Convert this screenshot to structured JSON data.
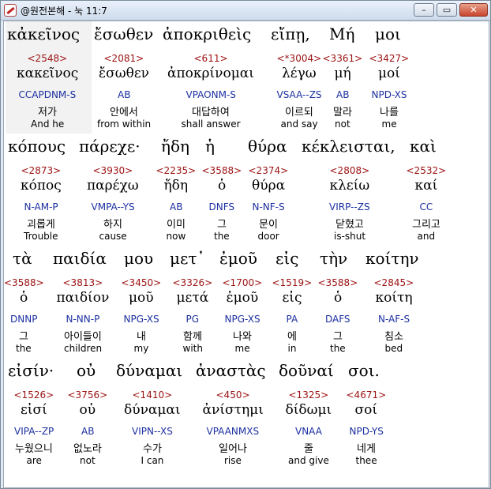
{
  "window": {
    "title": "@원전본해 - 눅 11:7",
    "min_label": "–",
    "max_label": "▭",
    "close_label": "✕"
  },
  "lines": [
    {
      "words": [
        {
          "greek": "κἀκεῖνος",
          "strong": "<2548>",
          "lemma": "κακεῖνος",
          "morph": "CCAPDNM-S",
          "korean": "저가",
          "english": "And he"
        },
        {
          "greek": "ἔσωθεν",
          "strong": "<2081>",
          "lemma": "ἔσωθεν",
          "morph": "AB",
          "korean": "안에서",
          "english": "from within"
        },
        {
          "greek": "ἀποκριθεὶς",
          "strong": "<611>",
          "lemma": "ἀποκρίνομαι",
          "morph": "VPAONM-S",
          "korean": "대답하여",
          "english": "shall answer"
        },
        {
          "greek": "εἴπῃ,",
          "strong": "<*3004>",
          "lemma": "λέγω",
          "morph": "VSAA--ZS",
          "korean": "이르되",
          "english": "and say"
        },
        {
          "greek": "Μή",
          "strong": "<3361>",
          "lemma": "μή",
          "morph": "AB",
          "korean": "말라",
          "english": "not"
        },
        {
          "greek": "μοι",
          "strong": "<3427>",
          "lemma": "μοί",
          "morph": "NPD-XS",
          "korean": "나를",
          "english": "me"
        }
      ]
    },
    {
      "words": [
        {
          "greek": "κόπους",
          "strong": "<2873>",
          "lemma": "κόπος",
          "morph": "N-AM-P",
          "korean": "괴롭게",
          "english": "Trouble"
        },
        {
          "greek": "πάρεχε·",
          "strong": "<3930>",
          "lemma": "παρέχω",
          "morph": "VMPA--YS",
          "korean": "하지",
          "english": "cause"
        },
        {
          "greek": "ἤδη",
          "strong": "<2235>",
          "lemma": "ἤδη",
          "morph": "AB",
          "korean": "이미",
          "english": "now"
        },
        {
          "greek": "ἡ",
          "strong": "<3588>",
          "lemma": "ὁ",
          "morph": "DNFS",
          "korean": "그",
          "english": "the"
        },
        {
          "greek": "θύρα",
          "strong": "<2374>",
          "lemma": "θύρα",
          "morph": "N-NF-S",
          "korean": "문이",
          "english": "door"
        },
        {
          "greek": "κέκλεισται,",
          "strong": "<2808>",
          "lemma": "κλείω",
          "morph": "VIRP--ZS",
          "korean": "닫혔고",
          "english": "is-shut"
        },
        {
          "greek": "καὶ",
          "strong": "<2532>",
          "lemma": "καί",
          "morph": "CC",
          "korean": "그리고",
          "english": "and"
        }
      ]
    },
    {
      "words": [
        {
          "greek": "τὰ",
          "strong": "<3588>",
          "lemma": "ὁ",
          "morph": "DNNP",
          "korean": "그",
          "english": "the"
        },
        {
          "greek": "παιδία",
          "strong": "<3813>",
          "lemma": "παιδίον",
          "morph": "N-NN-P",
          "korean": "아이들이",
          "english": "children"
        },
        {
          "greek": "μου",
          "strong": "<3450>",
          "lemma": "μοῦ",
          "morph": "NPG-XS",
          "korean": "내",
          "english": "my"
        },
        {
          "greek": "μετ᾽",
          "strong": "<3326>",
          "lemma": "μετά",
          "morph": "PG",
          "korean": "함께",
          "english": "with"
        },
        {
          "greek": "ἐμοῦ",
          "strong": "<1700>",
          "lemma": "ἐμοῦ",
          "morph": "NPG-XS",
          "korean": "나와",
          "english": "me"
        },
        {
          "greek": "εἰς",
          "strong": "<1519>",
          "lemma": "εἰς",
          "morph": "PA",
          "korean": "에",
          "english": "in"
        },
        {
          "greek": "τὴν",
          "strong": "<3588>",
          "lemma": "ὁ",
          "morph": "DAFS",
          "korean": "그",
          "english": "the"
        },
        {
          "greek": "κοίτην",
          "strong": "<2845>",
          "lemma": "κοίτη",
          "morph": "N-AF-S",
          "korean": "침소",
          "english": "bed"
        }
      ]
    },
    {
      "words": [
        {
          "greek": "εἰσίν·",
          "strong": "<1526>",
          "lemma": "εἰσί",
          "morph": "VIPA--ZP",
          "korean": "누웠으니",
          "english": "are"
        },
        {
          "greek": "οὐ",
          "strong": "<3756>",
          "lemma": "οὐ",
          "morph": "AB",
          "korean": "없노라",
          "english": "not"
        },
        {
          "greek": "δύναμαι",
          "strong": "<1410>",
          "lemma": "δύναμαι",
          "morph": "VIPN--XS",
          "korean": "수가",
          "english": "I can"
        },
        {
          "greek": "ἀναστὰς",
          "strong": "<450>",
          "lemma": "ἀνίστημι",
          "morph": "VPAANMXS",
          "korean": "일어나",
          "english": "rise"
        },
        {
          "greek": "δοῦναί",
          "strong": "<1325>",
          "lemma": "δίδωμι",
          "morph": "VNAA",
          "korean": "줄",
          "english": "and give"
        },
        {
          "greek": "σοι.",
          "strong": "<4671>",
          "lemma": "σοί",
          "morph": "NPD-YS",
          "korean": "네게",
          "english": "thee"
        }
      ]
    }
  ]
}
